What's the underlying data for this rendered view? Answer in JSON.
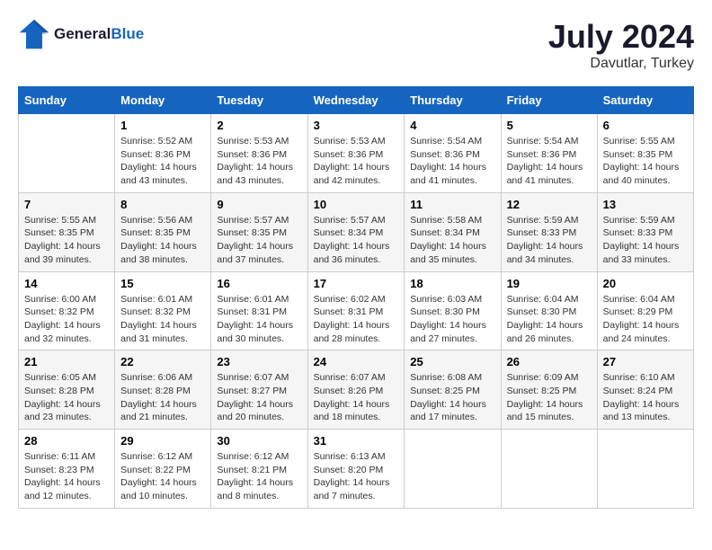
{
  "header": {
    "logo_line1": "General",
    "logo_line2": "Blue",
    "month": "July 2024",
    "location": "Davutlar, Turkey"
  },
  "days_of_week": [
    "Sunday",
    "Monday",
    "Tuesday",
    "Wednesday",
    "Thursday",
    "Friday",
    "Saturday"
  ],
  "weeks": [
    [
      {
        "day": "",
        "content": ""
      },
      {
        "day": "1",
        "content": "Sunrise: 5:52 AM\nSunset: 8:36 PM\nDaylight: 14 hours\nand 43 minutes."
      },
      {
        "day": "2",
        "content": "Sunrise: 5:53 AM\nSunset: 8:36 PM\nDaylight: 14 hours\nand 43 minutes."
      },
      {
        "day": "3",
        "content": "Sunrise: 5:53 AM\nSunset: 8:36 PM\nDaylight: 14 hours\nand 42 minutes."
      },
      {
        "day": "4",
        "content": "Sunrise: 5:54 AM\nSunset: 8:36 PM\nDaylight: 14 hours\nand 41 minutes."
      },
      {
        "day": "5",
        "content": "Sunrise: 5:54 AM\nSunset: 8:36 PM\nDaylight: 14 hours\nand 41 minutes."
      },
      {
        "day": "6",
        "content": "Sunrise: 5:55 AM\nSunset: 8:35 PM\nDaylight: 14 hours\nand 40 minutes."
      }
    ],
    [
      {
        "day": "7",
        "content": "Sunrise: 5:55 AM\nSunset: 8:35 PM\nDaylight: 14 hours\nand 39 minutes."
      },
      {
        "day": "8",
        "content": "Sunrise: 5:56 AM\nSunset: 8:35 PM\nDaylight: 14 hours\nand 38 minutes."
      },
      {
        "day": "9",
        "content": "Sunrise: 5:57 AM\nSunset: 8:35 PM\nDaylight: 14 hours\nand 37 minutes."
      },
      {
        "day": "10",
        "content": "Sunrise: 5:57 AM\nSunset: 8:34 PM\nDaylight: 14 hours\nand 36 minutes."
      },
      {
        "day": "11",
        "content": "Sunrise: 5:58 AM\nSunset: 8:34 PM\nDaylight: 14 hours\nand 35 minutes."
      },
      {
        "day": "12",
        "content": "Sunrise: 5:59 AM\nSunset: 8:33 PM\nDaylight: 14 hours\nand 34 minutes."
      },
      {
        "day": "13",
        "content": "Sunrise: 5:59 AM\nSunset: 8:33 PM\nDaylight: 14 hours\nand 33 minutes."
      }
    ],
    [
      {
        "day": "14",
        "content": "Sunrise: 6:00 AM\nSunset: 8:32 PM\nDaylight: 14 hours\nand 32 minutes."
      },
      {
        "day": "15",
        "content": "Sunrise: 6:01 AM\nSunset: 8:32 PM\nDaylight: 14 hours\nand 31 minutes."
      },
      {
        "day": "16",
        "content": "Sunrise: 6:01 AM\nSunset: 8:31 PM\nDaylight: 14 hours\nand 30 minutes."
      },
      {
        "day": "17",
        "content": "Sunrise: 6:02 AM\nSunset: 8:31 PM\nDaylight: 14 hours\nand 28 minutes."
      },
      {
        "day": "18",
        "content": "Sunrise: 6:03 AM\nSunset: 8:30 PM\nDaylight: 14 hours\nand 27 minutes."
      },
      {
        "day": "19",
        "content": "Sunrise: 6:04 AM\nSunset: 8:30 PM\nDaylight: 14 hours\nand 26 minutes."
      },
      {
        "day": "20",
        "content": "Sunrise: 6:04 AM\nSunset: 8:29 PM\nDaylight: 14 hours\nand 24 minutes."
      }
    ],
    [
      {
        "day": "21",
        "content": "Sunrise: 6:05 AM\nSunset: 8:28 PM\nDaylight: 14 hours\nand 23 minutes."
      },
      {
        "day": "22",
        "content": "Sunrise: 6:06 AM\nSunset: 8:28 PM\nDaylight: 14 hours\nand 21 minutes."
      },
      {
        "day": "23",
        "content": "Sunrise: 6:07 AM\nSunset: 8:27 PM\nDaylight: 14 hours\nand 20 minutes."
      },
      {
        "day": "24",
        "content": "Sunrise: 6:07 AM\nSunset: 8:26 PM\nDaylight: 14 hours\nand 18 minutes."
      },
      {
        "day": "25",
        "content": "Sunrise: 6:08 AM\nSunset: 8:25 PM\nDaylight: 14 hours\nand 17 minutes."
      },
      {
        "day": "26",
        "content": "Sunrise: 6:09 AM\nSunset: 8:25 PM\nDaylight: 14 hours\nand 15 minutes."
      },
      {
        "day": "27",
        "content": "Sunrise: 6:10 AM\nSunset: 8:24 PM\nDaylight: 14 hours\nand 13 minutes."
      }
    ],
    [
      {
        "day": "28",
        "content": "Sunrise: 6:11 AM\nSunset: 8:23 PM\nDaylight: 14 hours\nand 12 minutes."
      },
      {
        "day": "29",
        "content": "Sunrise: 6:12 AM\nSunset: 8:22 PM\nDaylight: 14 hours\nand 10 minutes."
      },
      {
        "day": "30",
        "content": "Sunrise: 6:12 AM\nSunset: 8:21 PM\nDaylight: 14 hours\nand 8 minutes."
      },
      {
        "day": "31",
        "content": "Sunrise: 6:13 AM\nSunset: 8:20 PM\nDaylight: 14 hours\nand 7 minutes."
      },
      {
        "day": "",
        "content": ""
      },
      {
        "day": "",
        "content": ""
      },
      {
        "day": "",
        "content": ""
      }
    ]
  ]
}
